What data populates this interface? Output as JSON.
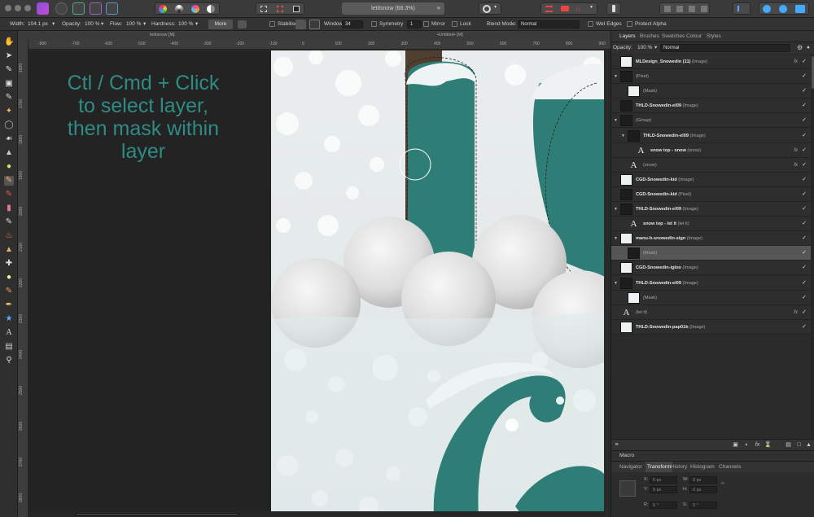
{
  "window": {
    "title": "letitsnow (68.3%)",
    "doc_tab_left": "letitsnow [M]",
    "doc_tab_right": "•Untitled• [M]"
  },
  "context_toolbar": {
    "width_label": "Width:",
    "width_value": "104.1 px",
    "opacity_label": "Opacity:",
    "opacity_value": "100 %",
    "flow_label": "Flow:",
    "flow_value": "100 %",
    "hardness_label": "Hardness:",
    "hardness_value": "100 %",
    "more_label": "More",
    "stabiliser_label": "Stabiliser",
    "window_label": "Window",
    "window_value": "34",
    "symmetry_label": "Symmetry",
    "symmetry_value": "1",
    "mirror_label": "Mirror",
    "lock_label": "Lock",
    "blend_mode_label": "Blend Mode:",
    "blend_mode_value": "Normal",
    "wet_edges_label": "Wet Edges",
    "protect_alpha_label": "Protect Alpha"
  },
  "rulers": {
    "horizontal": [
      "-800",
      "-700",
      "-600",
      "-500",
      "-400",
      "-300",
      "-200",
      "-100",
      "0",
      "100",
      "200",
      "300",
      "400",
      "500",
      "600",
      "700",
      "800",
      "900",
      "1000",
      "1100"
    ],
    "vertical": [
      "1600",
      "1700",
      "1800",
      "1900",
      "2000",
      "2100",
      "2200",
      "2300",
      "2400",
      "2500",
      "2600",
      "2700",
      "2800"
    ]
  },
  "canvas": {
    "instruction_lines": [
      "Ctl / Cmd + Click",
      "to select layer,",
      "then mask within",
      "layer"
    ]
  },
  "panel": {
    "tabs": [
      "Layers",
      "Brushes",
      "Swatches",
      "Colour",
      "Styles"
    ],
    "active_tab": "Layers",
    "opacity_label": "Opacity:",
    "opacity_value": "100 %",
    "blend_value": "Normal",
    "layers": [
      {
        "name": "MLDesign_Snowedin (11)",
        "kind": "(Image)",
        "fx": true,
        "thumb": "light",
        "indent": 0,
        "expander": ""
      },
      {
        "name": "",
        "kind": "(Pixel)",
        "fx": false,
        "thumb": "dark",
        "indent": 0,
        "expander": "▼"
      },
      {
        "name": "",
        "kind": "(Mask)",
        "fx": false,
        "thumb": "light",
        "indent": 1,
        "expander": ""
      },
      {
        "name": "THLD-Snowedin-el09",
        "kind": "(Image)",
        "fx": false,
        "thumb": "dark",
        "indent": 0,
        "expander": ""
      },
      {
        "name": "",
        "kind": "(Group)",
        "fx": false,
        "thumb": "dark",
        "indent": 0,
        "expander": "▼"
      },
      {
        "name": "THLD-Snowedin-el09",
        "kind": "(Image)",
        "fx": false,
        "thumb": "dark",
        "indent": 1,
        "expander": "▼"
      },
      {
        "name": "snow top - snow",
        "kind": "(snow)",
        "fx": true,
        "thumb": "text",
        "indent": 2,
        "expander": ""
      },
      {
        "name": "",
        "kind": "(snow)",
        "fx": true,
        "thumb": "text",
        "indent": 1,
        "expander": ""
      },
      {
        "name": "CGD-Snowedin-kid",
        "kind": "(Image)",
        "fx": false,
        "thumb": "light",
        "indent": 0,
        "expander": ""
      },
      {
        "name": "CGD-Snowedin-kid",
        "kind": "(Pixel)",
        "fx": false,
        "thumb": "dark",
        "indent": 0,
        "expander": ""
      },
      {
        "name": "THLD-Snowedin-el09",
        "kind": "(Image)",
        "fx": false,
        "thumb": "dark",
        "indent": 0,
        "expander": "▼"
      },
      {
        "name": "snow top - let it",
        "kind": "(let it)",
        "fx": false,
        "thumb": "text",
        "indent": 1,
        "expander": ""
      },
      {
        "name": "manu-b-snowedin-sign",
        "kind": "(Image)",
        "fx": false,
        "thumb": "light",
        "indent": 0,
        "expander": "▼"
      },
      {
        "name": "",
        "kind": "(Mask)",
        "fx": false,
        "thumb": "dark",
        "indent": 1,
        "expander": "",
        "selected": true
      },
      {
        "name": "CGD-Snowedin-igloo",
        "kind": "(Image)",
        "fx": false,
        "thumb": "light",
        "indent": 0,
        "expander": ""
      },
      {
        "name": "THLD-Snowedin-el09",
        "kind": "(Image)",
        "fx": false,
        "thumb": "dark",
        "indent": 0,
        "expander": "▼"
      },
      {
        "name": "",
        "kind": "(Mask)",
        "fx": false,
        "thumb": "light",
        "indent": 1,
        "expander": ""
      },
      {
        "name": "",
        "kind": "(let it)",
        "fx": true,
        "thumb": "text",
        "indent": 0,
        "expander": ""
      },
      {
        "name": "THLD-Snowedin-pap01b",
        "kind": "(Image)",
        "fx": false,
        "thumb": "light",
        "indent": 0,
        "expander": ""
      }
    ],
    "macro_label": "Macro",
    "bottom_tabs": [
      "Navigator",
      "Transform",
      "History",
      "Histogram",
      "Channels"
    ],
    "active_bottom_tab": "Transform",
    "transform": {
      "x_label": "X:",
      "x_value": "0 px",
      "y_label": "Y:",
      "y_value": "0 px",
      "w_label": "W:",
      "w_value": "0 px",
      "h_label": "H:",
      "h_value": "0 px",
      "r_label": "R:",
      "r_value": "0 °",
      "s_label": "S:",
      "s_value": "0 °"
    }
  },
  "colors": {
    "teal": "#2e7d76",
    "snow": "#eef2f2",
    "instruction": "#2f8b84"
  }
}
